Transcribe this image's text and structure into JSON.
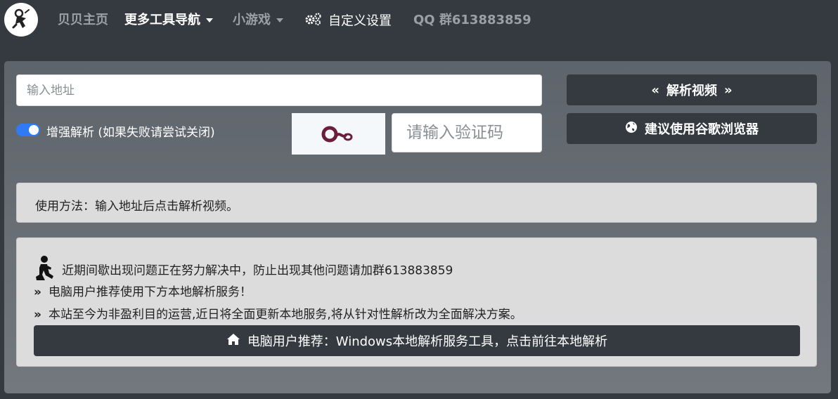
{
  "nav": {
    "items": [
      "贝贝主页",
      "更多工具导航",
      "小游戏",
      "自定义设置",
      "QQ 群613883859"
    ]
  },
  "form": {
    "url_placeholder": "输入地址",
    "toggle_label": "增强解析 (如果失败请尝试关闭)",
    "toggle_on": true,
    "captcha_placeholder": "请输入验证码",
    "parse_button": "解析视频",
    "browser_button": "建议使用谷歌浏览器"
  },
  "usage": {
    "text": "使用方法：输入地址后点击解析视频。"
  },
  "notice": {
    "line1": "近期间歇出现问题正在努力解决中，防止出现其他问题请加群613883859",
    "line2": "电脑用户推荐使用下方本地解析服务！",
    "line3": "本站至今为非盈利目的运营,近日将全面更新本地服务,将从针对性解析改为全面解决方案。",
    "prefix_glyph": "»",
    "local_button": "电脑用户推荐：Windows本地解析服务工具，点击前往本地解析"
  },
  "icons": {
    "logo": "astronaut-logo-icon",
    "settings": "gears-icon",
    "parse_left": "angle-double-left-icon",
    "parse_right": "angle-double-right-icon",
    "browser": "globe-icon",
    "notice": "praying-person-icon",
    "home": "home-icon"
  },
  "colors": {
    "navbar": "#343a40",
    "toggle": "#2f7bf5",
    "button": "#343a40",
    "captcha_text": "#6b1e3a"
  }
}
